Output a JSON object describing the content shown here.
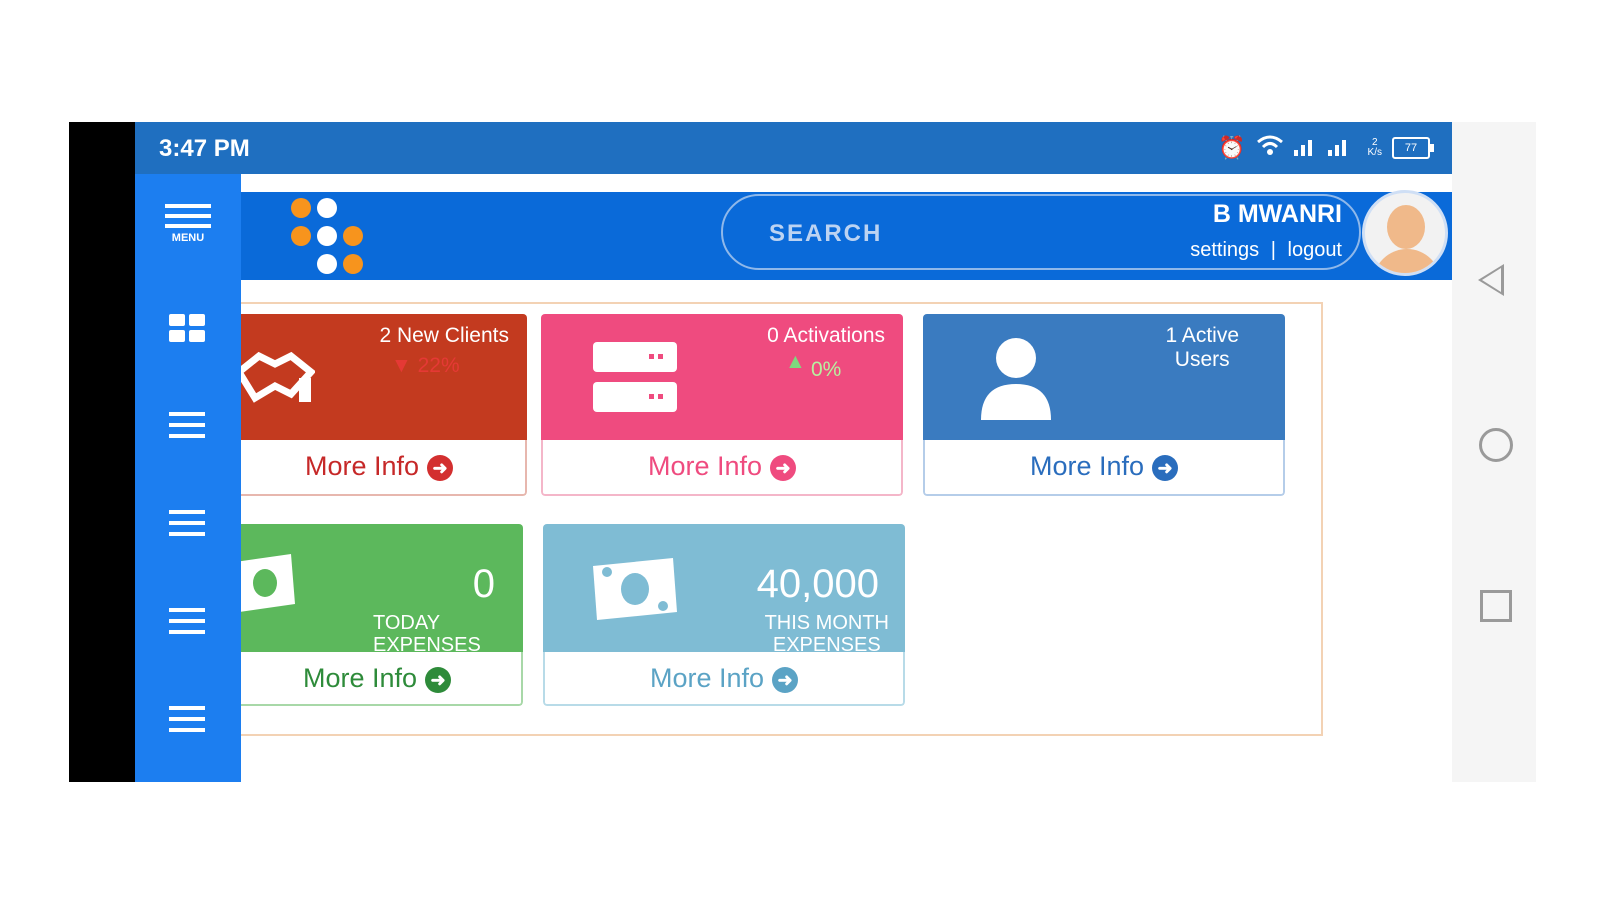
{
  "status_bar": {
    "time": "3:47 PM",
    "speed_top": "2",
    "speed_unit": "K/s",
    "battery": "77"
  },
  "sidebar": {
    "menu_label": "MENU"
  },
  "header": {
    "search_placeholder": "SEARCH",
    "user_name": "B MWANRI",
    "settings_link": "settings",
    "separator": "|",
    "logout_link": "logout"
  },
  "cards": [
    {
      "label": "2 New Clients",
      "trend": "▼ 22%",
      "more": "More Info",
      "color": "#c33a1f",
      "accent": "#d32f2f"
    },
    {
      "label": "0 Activations",
      "trend_arrow": "▲",
      "trend": "0%",
      "more": "More Info",
      "color": "#ef4b7f",
      "accent": "#ef4b7f"
    },
    {
      "label_line1": "1 Active",
      "label_line2": "Users",
      "more": "More Info",
      "color": "#3a7bc0",
      "accent": "#2a6dbd"
    },
    {
      "value": "0",
      "label_line1": "TODAY",
      "label_line2": "EXPENSES",
      "more": "More Info",
      "color": "#5cb85c",
      "accent": "#2e8b3a"
    },
    {
      "value": "40,000",
      "label_line1": "THIS MONTH",
      "label_line2": "EXPENSES",
      "more": "More Info",
      "color": "#7fbcd4",
      "accent": "#5ba3c5"
    }
  ]
}
